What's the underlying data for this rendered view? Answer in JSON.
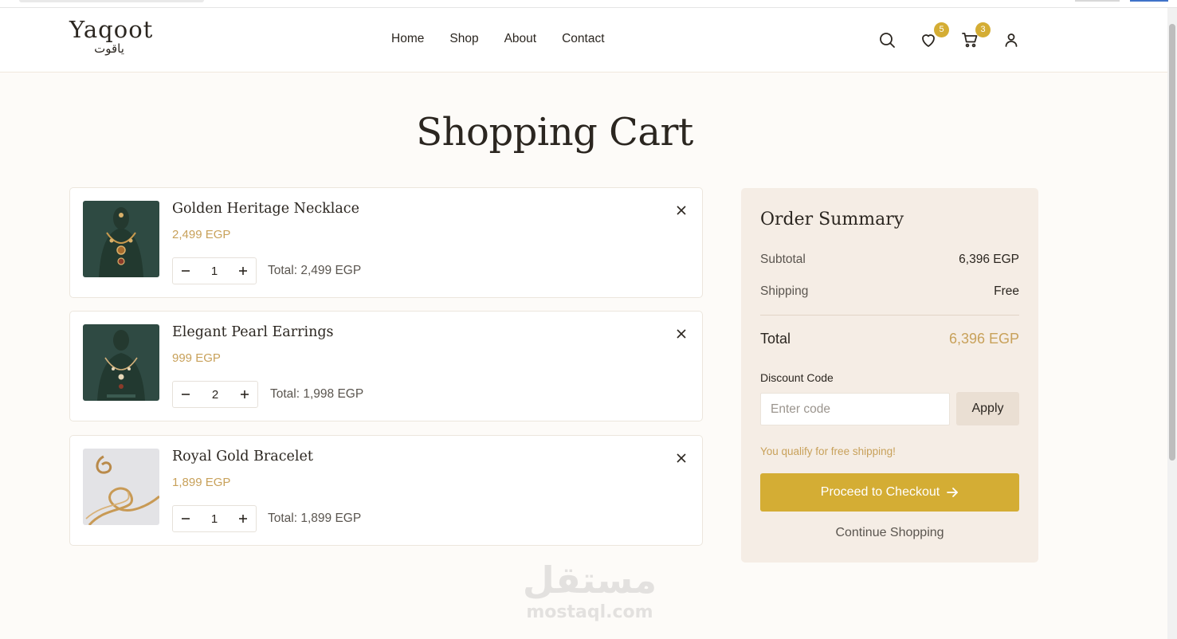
{
  "brand": {
    "name_en": "Yaqoot",
    "name_ar": "ياقوت"
  },
  "nav": {
    "items": [
      "Home",
      "Shop",
      "About",
      "Contact"
    ]
  },
  "header_icons": {
    "search": "search-icon",
    "wishlist": {
      "icon": "heart-icon",
      "count": "5"
    },
    "cart": {
      "icon": "cart-icon",
      "count": "3"
    },
    "account": "user-icon"
  },
  "page": {
    "title": "Shopping Cart"
  },
  "cart": {
    "items": [
      {
        "name": "Golden Heritage Necklace",
        "price": "2,499 EGP",
        "qty": "1",
        "total": "Total: 2,499 EGP"
      },
      {
        "name": "Elegant Pearl Earrings",
        "price": "999 EGP",
        "qty": "2",
        "total": "Total: 1,998 EGP"
      },
      {
        "name": "Royal Gold Bracelet",
        "price": "1,899 EGP",
        "qty": "1",
        "total": "Total: 1,899 EGP"
      }
    ]
  },
  "summary": {
    "title": "Order Summary",
    "subtotal_label": "Subtotal",
    "subtotal_value": "6,396 EGP",
    "shipping_label": "Shipping",
    "shipping_value": "Free",
    "total_label": "Total",
    "total_value": "6,396 EGP",
    "discount_label": "Discount Code",
    "discount_placeholder": "Enter code",
    "apply_label": "Apply",
    "free_shipping_note": "You qualify for free shipping!",
    "checkout_label": "Proceed to Checkout",
    "continue_label": "Continue Shopping"
  },
  "watermark": {
    "ar": "مستقل",
    "en": "mostaql.com"
  },
  "colors": {
    "accent": "#d4ad34",
    "price": "#c8a15a",
    "background": "#fdfbf8",
    "summary_bg": "#f5ede5"
  }
}
